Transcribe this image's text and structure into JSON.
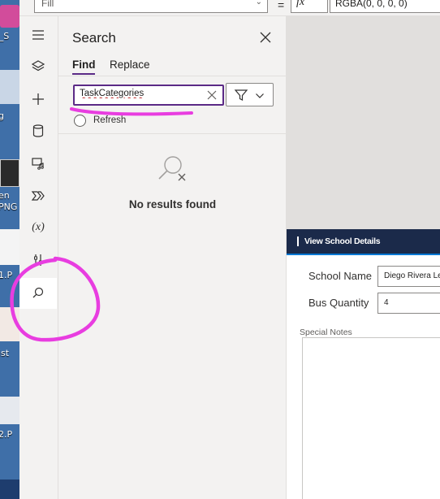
{
  "desktop": {
    "labels": [
      "e_S",
      "g",
      "en",
      "PNG",
      "1.P",
      "ist",
      "2.P"
    ]
  },
  "topbar": {
    "property_value": "Fill",
    "equals": "=",
    "fx_label": "fx",
    "formula_text": "RGBA(0, 0, 0, 0)"
  },
  "rail": {
    "items": [
      {
        "icon": "hamburger-menu-icon"
      },
      {
        "icon": "layers-icon"
      },
      {
        "icon": "plus-icon"
      },
      {
        "icon": "data-cylinder-icon"
      },
      {
        "icon": "media-icon"
      },
      {
        "icon": "power-automate-icon"
      },
      {
        "icon": "variables-icon",
        "label": "(x)"
      },
      {
        "icon": "advanced-tools-icon"
      },
      {
        "icon": "search-icon",
        "active": true
      }
    ]
  },
  "search_pane": {
    "title": "Search",
    "tabs": {
      "find": "Find",
      "replace": "Replace"
    },
    "query": "TaskCategories",
    "refresh_label": "Refresh",
    "empty_state": "No results found"
  },
  "app": {
    "header": "View School Details",
    "fields": [
      {
        "label": "School Name",
        "value": "Diego Rivera Le"
      },
      {
        "label": "Bus Quantity",
        "value": "4"
      }
    ],
    "notes_label": "Special Notes"
  },
  "colors": {
    "accent": "#5b2a86",
    "annotation": "#e83de0",
    "app_header": "#1b2a4a"
  }
}
